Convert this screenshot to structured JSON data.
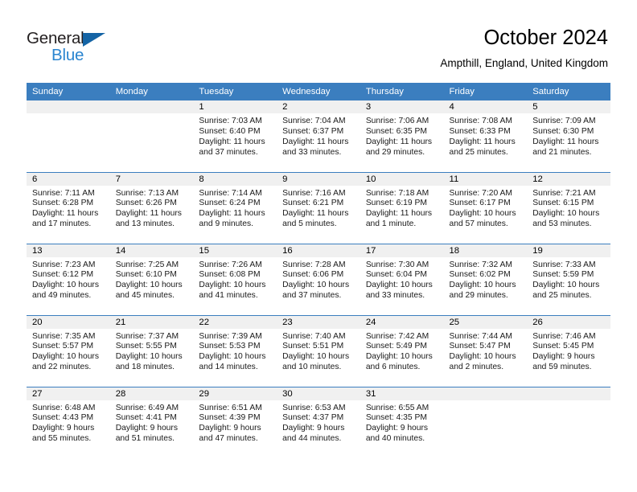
{
  "logo": {
    "word_top": "General",
    "word_bottom": "Blue",
    "triangle_icon": "triangle-icon",
    "color_dark": "#231f20",
    "color_blue": "#2a85d0"
  },
  "header": {
    "title": "October 2024",
    "location": "Ampthill, England, United Kingdom"
  },
  "theme": {
    "header_blue": "#3b7ebf",
    "daynum_gray": "#f0f0f0",
    "text_black": "#000000"
  },
  "calendar": {
    "weekday_headers": [
      "Sunday",
      "Monday",
      "Tuesday",
      "Wednesday",
      "Thursday",
      "Friday",
      "Saturday"
    ],
    "labels": {
      "sunrise": "Sunrise:",
      "sunset": "Sunset:",
      "daylight": "Daylight:"
    },
    "weeks": [
      [
        {
          "day": "",
          "blank": true
        },
        {
          "day": "",
          "blank": true
        },
        {
          "day": "1",
          "sunrise": "Sunrise: 7:03 AM",
          "sunset": "Sunset: 6:40 PM",
          "daylight": "Daylight: 11 hours and 37 minutes."
        },
        {
          "day": "2",
          "sunrise": "Sunrise: 7:04 AM",
          "sunset": "Sunset: 6:37 PM",
          "daylight": "Daylight: 11 hours and 33 minutes."
        },
        {
          "day": "3",
          "sunrise": "Sunrise: 7:06 AM",
          "sunset": "Sunset: 6:35 PM",
          "daylight": "Daylight: 11 hours and 29 minutes."
        },
        {
          "day": "4",
          "sunrise": "Sunrise: 7:08 AM",
          "sunset": "Sunset: 6:33 PM",
          "daylight": "Daylight: 11 hours and 25 minutes."
        },
        {
          "day": "5",
          "sunrise": "Sunrise: 7:09 AM",
          "sunset": "Sunset: 6:30 PM",
          "daylight": "Daylight: 11 hours and 21 minutes."
        }
      ],
      [
        {
          "day": "6",
          "sunrise": "Sunrise: 7:11 AM",
          "sunset": "Sunset: 6:28 PM",
          "daylight": "Daylight: 11 hours and 17 minutes."
        },
        {
          "day": "7",
          "sunrise": "Sunrise: 7:13 AM",
          "sunset": "Sunset: 6:26 PM",
          "daylight": "Daylight: 11 hours and 13 minutes."
        },
        {
          "day": "8",
          "sunrise": "Sunrise: 7:14 AM",
          "sunset": "Sunset: 6:24 PM",
          "daylight": "Daylight: 11 hours and 9 minutes."
        },
        {
          "day": "9",
          "sunrise": "Sunrise: 7:16 AM",
          "sunset": "Sunset: 6:21 PM",
          "daylight": "Daylight: 11 hours and 5 minutes."
        },
        {
          "day": "10",
          "sunrise": "Sunrise: 7:18 AM",
          "sunset": "Sunset: 6:19 PM",
          "daylight": "Daylight: 11 hours and 1 minute."
        },
        {
          "day": "11",
          "sunrise": "Sunrise: 7:20 AM",
          "sunset": "Sunset: 6:17 PM",
          "daylight": "Daylight: 10 hours and 57 minutes."
        },
        {
          "day": "12",
          "sunrise": "Sunrise: 7:21 AM",
          "sunset": "Sunset: 6:15 PM",
          "daylight": "Daylight: 10 hours and 53 minutes."
        }
      ],
      [
        {
          "day": "13",
          "sunrise": "Sunrise: 7:23 AM",
          "sunset": "Sunset: 6:12 PM",
          "daylight": "Daylight: 10 hours and 49 minutes."
        },
        {
          "day": "14",
          "sunrise": "Sunrise: 7:25 AM",
          "sunset": "Sunset: 6:10 PM",
          "daylight": "Daylight: 10 hours and 45 minutes."
        },
        {
          "day": "15",
          "sunrise": "Sunrise: 7:26 AM",
          "sunset": "Sunset: 6:08 PM",
          "daylight": "Daylight: 10 hours and 41 minutes."
        },
        {
          "day": "16",
          "sunrise": "Sunrise: 7:28 AM",
          "sunset": "Sunset: 6:06 PM",
          "daylight": "Daylight: 10 hours and 37 minutes."
        },
        {
          "day": "17",
          "sunrise": "Sunrise: 7:30 AM",
          "sunset": "Sunset: 6:04 PM",
          "daylight": "Daylight: 10 hours and 33 minutes."
        },
        {
          "day": "18",
          "sunrise": "Sunrise: 7:32 AM",
          "sunset": "Sunset: 6:02 PM",
          "daylight": "Daylight: 10 hours and 29 minutes."
        },
        {
          "day": "19",
          "sunrise": "Sunrise: 7:33 AM",
          "sunset": "Sunset: 5:59 PM",
          "daylight": "Daylight: 10 hours and 25 minutes."
        }
      ],
      [
        {
          "day": "20",
          "sunrise": "Sunrise: 7:35 AM",
          "sunset": "Sunset: 5:57 PM",
          "daylight": "Daylight: 10 hours and 22 minutes."
        },
        {
          "day": "21",
          "sunrise": "Sunrise: 7:37 AM",
          "sunset": "Sunset: 5:55 PM",
          "daylight": "Daylight: 10 hours and 18 minutes."
        },
        {
          "day": "22",
          "sunrise": "Sunrise: 7:39 AM",
          "sunset": "Sunset: 5:53 PM",
          "daylight": "Daylight: 10 hours and 14 minutes."
        },
        {
          "day": "23",
          "sunrise": "Sunrise: 7:40 AM",
          "sunset": "Sunset: 5:51 PM",
          "daylight": "Daylight: 10 hours and 10 minutes."
        },
        {
          "day": "24",
          "sunrise": "Sunrise: 7:42 AM",
          "sunset": "Sunset: 5:49 PM",
          "daylight": "Daylight: 10 hours and 6 minutes."
        },
        {
          "day": "25",
          "sunrise": "Sunrise: 7:44 AM",
          "sunset": "Sunset: 5:47 PM",
          "daylight": "Daylight: 10 hours and 2 minutes."
        },
        {
          "day": "26",
          "sunrise": "Sunrise: 7:46 AM",
          "sunset": "Sunset: 5:45 PM",
          "daylight": "Daylight: 9 hours and 59 minutes."
        }
      ],
      [
        {
          "day": "27",
          "sunrise": "Sunrise: 6:48 AM",
          "sunset": "Sunset: 4:43 PM",
          "daylight": "Daylight: 9 hours and 55 minutes."
        },
        {
          "day": "28",
          "sunrise": "Sunrise: 6:49 AM",
          "sunset": "Sunset: 4:41 PM",
          "daylight": "Daylight: 9 hours and 51 minutes."
        },
        {
          "day": "29",
          "sunrise": "Sunrise: 6:51 AM",
          "sunset": "Sunset: 4:39 PM",
          "daylight": "Daylight: 9 hours and 47 minutes."
        },
        {
          "day": "30",
          "sunrise": "Sunrise: 6:53 AM",
          "sunset": "Sunset: 4:37 PM",
          "daylight": "Daylight: 9 hours and 44 minutes."
        },
        {
          "day": "31",
          "sunrise": "Sunrise: 6:55 AM",
          "sunset": "Sunset: 4:35 PM",
          "daylight": "Daylight: 9 hours and 40 minutes."
        },
        {
          "day": "",
          "blank": true
        },
        {
          "day": "",
          "blank": true
        }
      ]
    ]
  }
}
